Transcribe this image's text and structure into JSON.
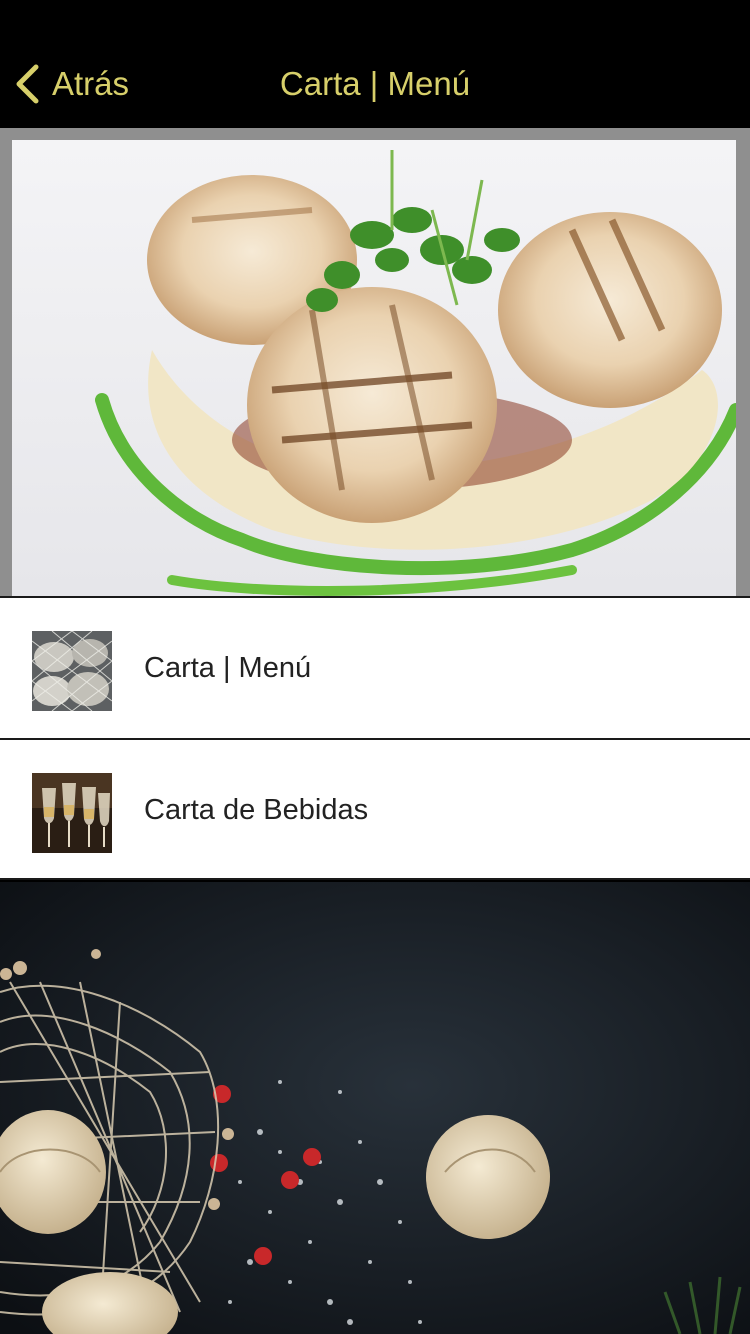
{
  "nav": {
    "back_label": "Atrás",
    "title": "Carta | Menú",
    "accent_color": "#d7cf6a"
  },
  "menu": {
    "items": [
      {
        "label": "Carta | Menú",
        "thumb_icon": "clams-net-photo"
      },
      {
        "label": "Carta de Bebidas",
        "thumb_icon": "wine-glasses-photo"
      }
    ]
  }
}
